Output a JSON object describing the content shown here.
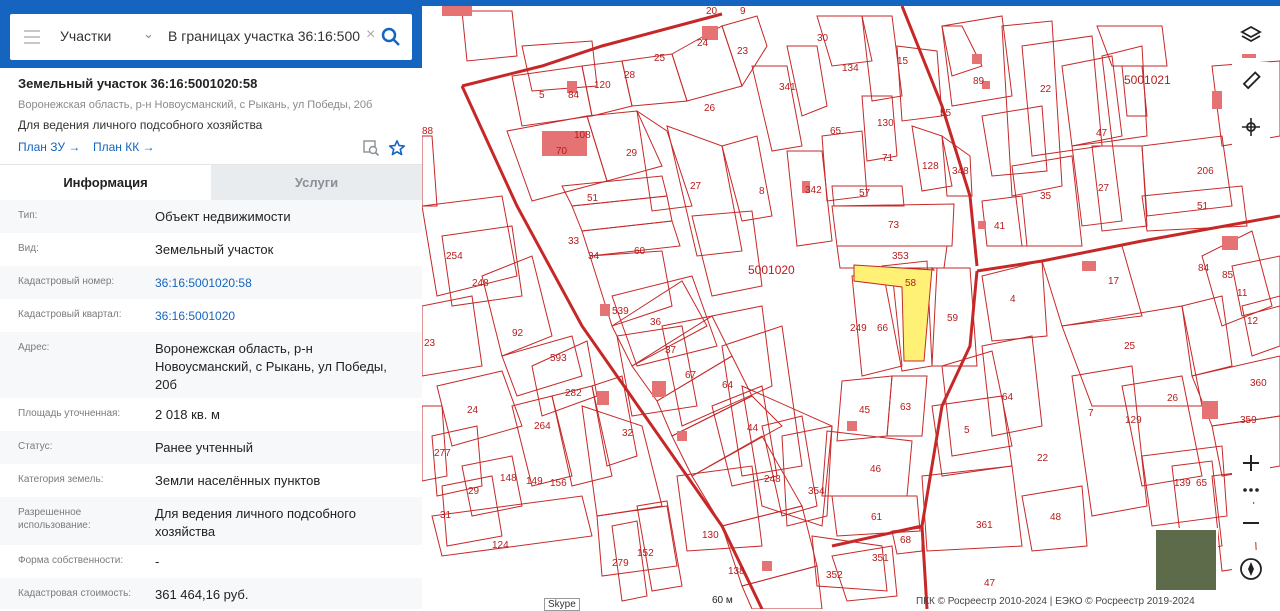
{
  "search": {
    "type_label": "Участки",
    "query": "В границах участка 36:16:500"
  },
  "object": {
    "title": "Земельный участок 36:16:5001020:58",
    "address_short": "Воронежская область, р-н Новоусманский, с Рыкань, ул Победы, 20б",
    "purpose": "Для ведения личного подсобного хозяйства",
    "links": [
      "План ЗУ →",
      "План КК →"
    ]
  },
  "tabs": [
    "Информация",
    "Услуги"
  ],
  "info": [
    {
      "key": "Тип:",
      "value": "Объект недвижимости"
    },
    {
      "key": "Вид:",
      "value": "Земельный участок"
    },
    {
      "key": "Кадастровый номер:",
      "value": "36:16:5001020:58"
    },
    {
      "key": "Кадастровый квартал:",
      "value": "36:16:5001020"
    },
    {
      "key": "Адрес:",
      "value": "Воронежская область, р-н Новоусманский, с Рыкань, ул Победы, 20б"
    },
    {
      "key": "Площадь уточненная:",
      "value": "2 018 кв. м"
    },
    {
      "key": "Статус:",
      "value": "Ранее учтенный"
    },
    {
      "key": "Категория земель:",
      "value": "Земли населённых пунктов"
    },
    {
      "key": "Разрешенное использование:",
      "value": "Для ведения личного подсобного хозяйства"
    },
    {
      "key": "Форма собственности:",
      "value": "-"
    },
    {
      "key": "Кадастровая стоимость:",
      "value": "361 464,16 руб."
    }
  ],
  "map": {
    "quarters": [
      "5001020",
      "5001021"
    ],
    "parcels": [
      "58",
      "353",
      "73",
      "57",
      "249",
      "66",
      "59",
      "45",
      "63",
      "46",
      "61",
      "68",
      "351",
      "352",
      "354",
      "248",
      "64",
      "44",
      "67",
      "37",
      "36",
      "539",
      "60",
      "34",
      "33",
      "32",
      "51",
      "27",
      "8",
      "342",
      "341",
      "30",
      "134",
      "15",
      "55",
      "128",
      "348",
      "130",
      "71",
      "65",
      "26",
      "25",
      "24",
      "23",
      "20",
      "9",
      "120",
      "28",
      "5",
      "70",
      "108",
      "29",
      "84",
      "254",
      "248",
      "92",
      "593",
      "282",
      "23",
      "24",
      "264",
      "156",
      "149",
      "148",
      "29",
      "31",
      "277",
      "124",
      "279",
      "152",
      "130",
      "138",
      "4",
      "17",
      "25",
      "7",
      "129",
      "26",
      "35",
      "27",
      "206",
      "51",
      "41",
      "89",
      "22",
      "47",
      "84",
      "85",
      "11",
      "12",
      "360",
      "359",
      "139",
      "65",
      "64",
      "5",
      "361",
      "48",
      "47",
      "88",
      "22"
    ],
    "scale": "60 м",
    "skype": "Skype",
    "attribution": "ПКК © Росреестр 2010-2024 | ЕЭКО © Росреестр 2019-2024",
    "selected_color": "#fff176",
    "boundary_color": "#c62828"
  }
}
